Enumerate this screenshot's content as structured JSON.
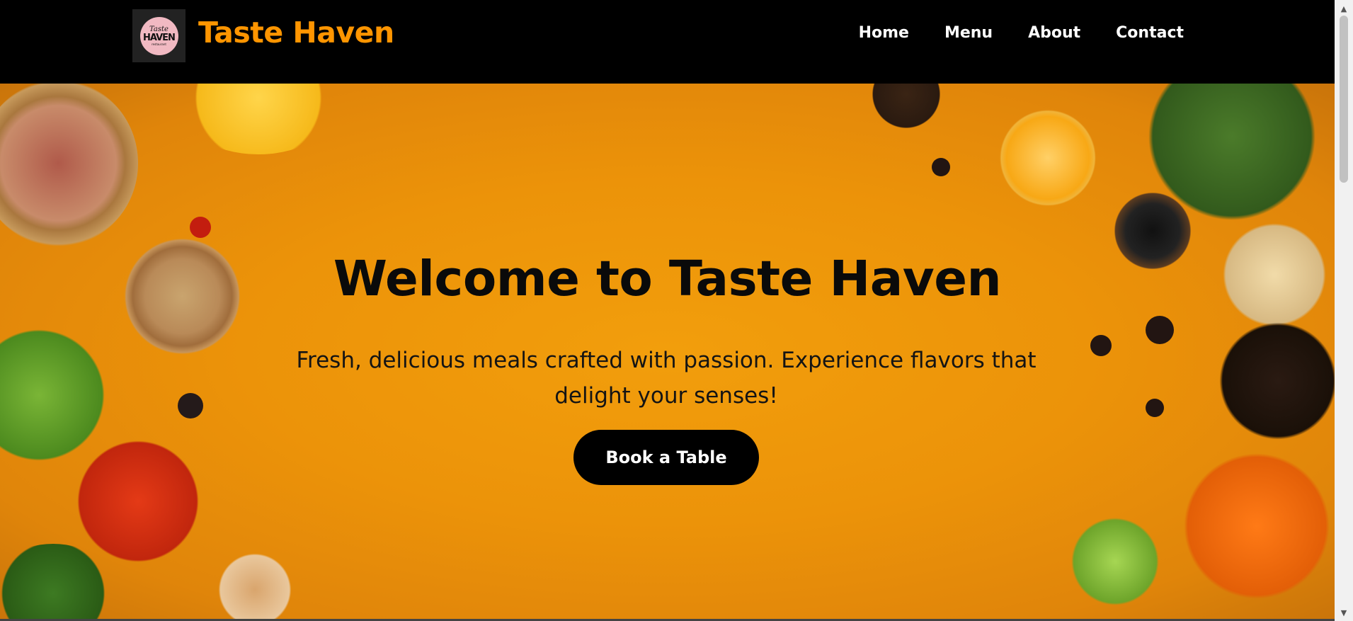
{
  "header": {
    "logo": {
      "line1": "Taste",
      "line2": "HAVEN",
      "line3": "restaurant"
    },
    "brand": "Taste Haven",
    "nav": [
      {
        "label": "Home"
      },
      {
        "label": "Menu"
      },
      {
        "label": "About"
      },
      {
        "label": "Contact"
      }
    ]
  },
  "hero": {
    "title": "Welcome to Taste Haven",
    "subtitle": "Fresh, delicious meals crafted with passion. Experience flavors that delight your senses!",
    "cta_label": "Book a Table"
  },
  "colors": {
    "brand": "#ff9500",
    "navbar_bg": "#000000",
    "hero_bg": "#ec9309",
    "cta_bg": "#000000"
  },
  "icons": [
    "scroll-up-arrow-icon",
    "scroll-down-arrow-icon"
  ]
}
